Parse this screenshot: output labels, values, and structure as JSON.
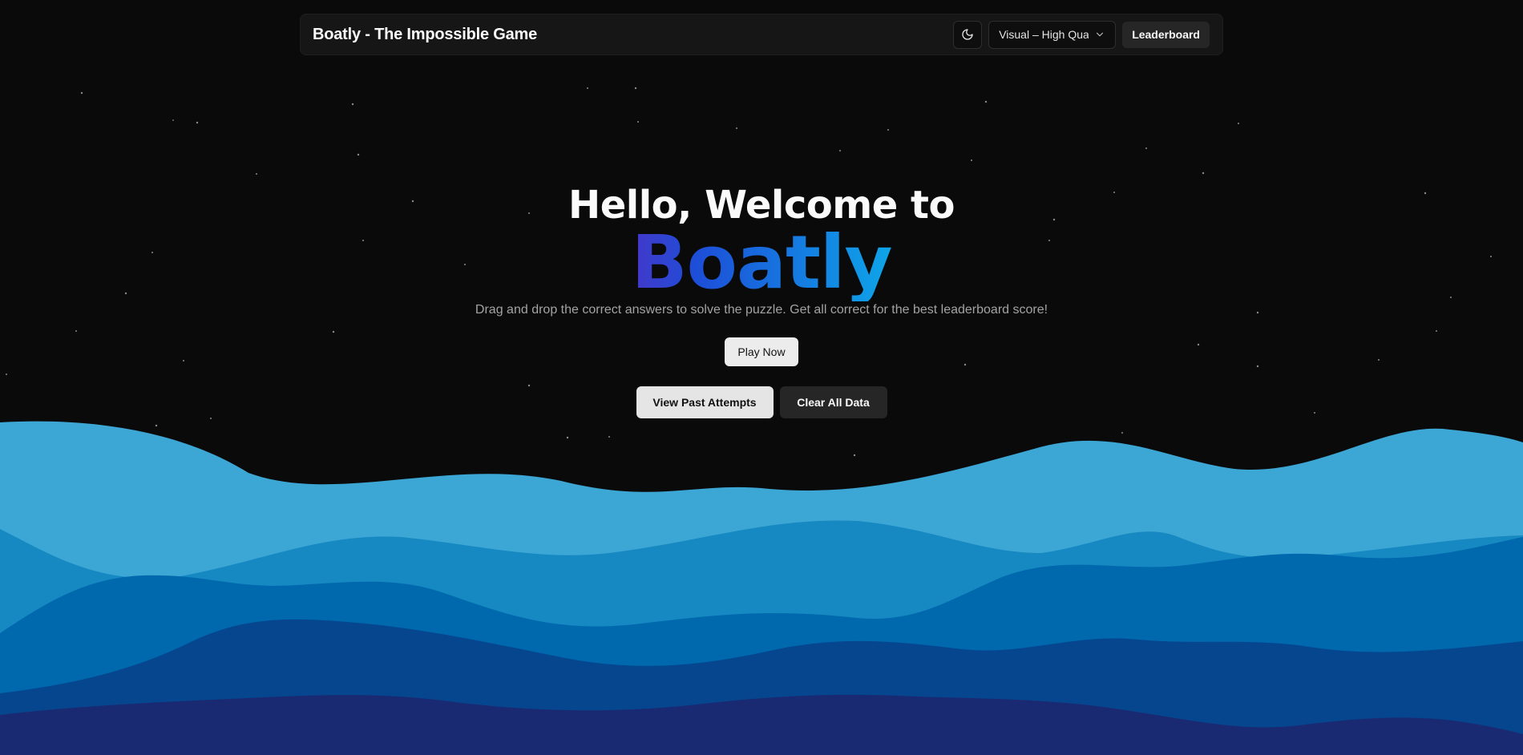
{
  "navbar": {
    "brand": "Boatly - The Impossible Game",
    "theme_toggle_icon": "moon-icon",
    "quality_select": {
      "value": "Visual – High Quality",
      "chevron_icon": "chevron-down-icon"
    },
    "leaderboard_label": "Leaderboard"
  },
  "hero": {
    "heading": "Hello, Welcome to",
    "brand": "Boatly",
    "subtitle": "Drag and drop the correct answers to solve the puzzle. Get all correct for the best leaderboard score!",
    "play_label": "Play Now",
    "past_attempts_label": "View Past Attempts",
    "clear_data_label": "Clear All Data"
  },
  "colors": {
    "background": "#0a0a0a",
    "wave_1": "#3ca6d4",
    "wave_2": "#1688c2",
    "wave_3": "#0068ad",
    "wave_4": "#05468f",
    "wave_5": "#1a2a72",
    "brand_gradient_start": "#4338ca",
    "brand_gradient_end": "#0ea5e9"
  }
}
